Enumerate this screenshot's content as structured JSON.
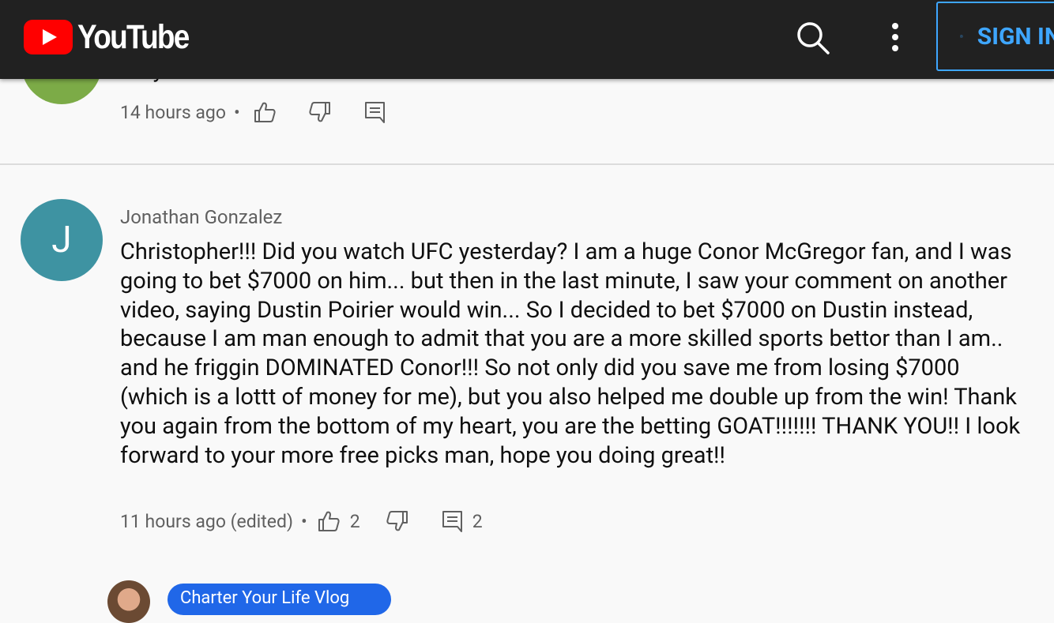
{
  "header": {
    "logo_text": "YouTube",
    "signin_label": "SIGN IN",
    "icons": [
      "youtube-logo",
      "search-icon",
      "more-vert-icon",
      "account-circle-icon"
    ]
  },
  "previous_comment": {
    "text": "Oh you mike",
    "time": "14 hours ago",
    "separator": "•"
  },
  "comment": {
    "avatar_letter": "J",
    "author": "Jonathan Gonzalez",
    "body": "Christopher!!! Did you watch UFC yesterday? I am a huge Conor McGregor fan, and I was going to bet $7000 on him... but then in the last minute, I saw your comment on another video, saying Dustin Poirier would win... So I decided to bet $7000 on Dustin instead, because I am man enough to admit that you are a more skilled sports bettor than I am.. and he friggin DOMINATED Conor!!! So not only did you save me from losing $7000 (which is a lottt of money for me), but you also helped me double up from the win! Thank you again from the bottom of my heart, you are the betting GOAT!!!!!!! THANK YOU!! I look forward to your more free picks man, hope you doing great!!",
    "time": "11 hours ago (edited)",
    "separator": "•",
    "likes": "2",
    "replies": "2"
  },
  "reply": {
    "creator_badge": "Charter Your Life Vlog"
  },
  "colors": {
    "topbar": "#212121",
    "youtube_red": "#ff0000",
    "link_blue": "#3ea6ff",
    "avatar_j": "#3e93a2",
    "avatar_prev": "#7cab47",
    "badge_blue": "#2067e8"
  }
}
